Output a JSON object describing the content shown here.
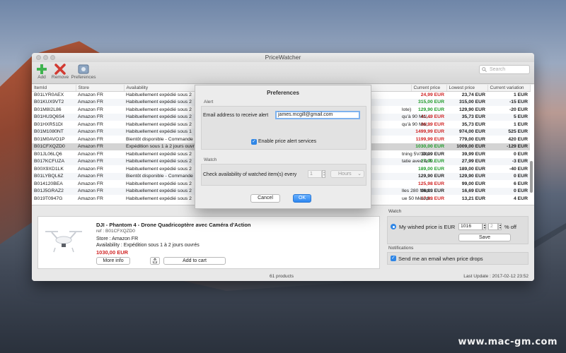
{
  "window": {
    "title": "PriceWatcher"
  },
  "toolbar": {
    "add_label": "Add",
    "remove_label": "Remove",
    "preferences_label": "Preferences",
    "search_placeholder": "Search"
  },
  "table": {
    "columns": [
      "ItemId",
      "Store",
      "Availability",
      "Current price",
      "Lowest price",
      "Current variation"
    ],
    "rows": [
      {
        "id": "B01LYR0AEX",
        "store": "Amazon FR",
        "avail": "Habituellement expédié sous 2",
        "extra": "",
        "current": "24,99 EUR",
        "current_color": "red",
        "lowest": "23,74 EUR",
        "variation": "1 EUR"
      },
      {
        "id": "B01KUX9VT2",
        "store": "Amazon FR",
        "avail": "Habituellement expédié sous 2",
        "extra": "",
        "current": "315,00 EUR",
        "current_color": "green",
        "lowest": "315,00 EUR",
        "variation": "-15 EUR"
      },
      {
        "id": "B01M8I2L86",
        "store": "Amazon FR",
        "avail": "Habituellement expédié sous 2",
        "extra": "lote)",
        "current": "129,90 EUR",
        "current_color": "green",
        "lowest": "129,90 EUR",
        "variation": "-20 EUR"
      },
      {
        "id": "B01HU3Q6S4",
        "store": "Amazon FR",
        "avail": "Habituellement expédié sous 2",
        "extra": "qu'à 90 Mo/...",
        "current": "41,49 EUR",
        "current_color": "red",
        "lowest": "35,73 EUR",
        "variation": "5 EUR"
      },
      {
        "id": "B01HXR51DI",
        "store": "Amazon FR",
        "avail": "Habituellement expédié sous 2",
        "extra": "qu'à 90 Mo/...",
        "current": "36,99 EUR",
        "current_color": "red",
        "lowest": "35,73 EUR",
        "variation": "1 EUR"
      },
      {
        "id": "B01M1080NT",
        "store": "Amazon FR",
        "avail": "Habituellement expédié sous 1",
        "extra": "",
        "current": "1499,99 EUR",
        "current_color": "red",
        "lowest": "974,00 EUR",
        "variation": "525 EUR"
      },
      {
        "id": "B01M0AVO1P",
        "store": "Amazon FR",
        "avail": "Bientôt disponible - Commande",
        "extra": "",
        "current": "1199,99 EUR",
        "current_color": "red",
        "lowest": "779,00 EUR",
        "variation": "420 EUR"
      },
      {
        "id": "B01CFXQZD0",
        "store": "Amazon FR",
        "avail": "Expédition sous 1 à 2 jours ouvr",
        "extra": "",
        "current": "1030,00 EUR",
        "current_color": "green",
        "lowest": "1009,00 EUR",
        "variation": "-129 EUR",
        "selected": true
      },
      {
        "id": "B01JL06LQ6",
        "store": "Amazon FR",
        "avail": "Habituellement expédié sous 2",
        "extra": "tning 5V/ 2A...",
        "current": "39,99 EUR",
        "current_color": "normal",
        "lowest": "39,99 EUR",
        "variation": "0 EUR"
      },
      {
        "id": "B017KCFUZA",
        "store": "Amazon FR",
        "avail": "Habituellement expédié sous 2",
        "extra": "tatie avec la T...",
        "current": "27,99 EUR",
        "current_color": "green",
        "lowest": "27,99 EUR",
        "variation": "-3 EUR"
      },
      {
        "id": "B00X9XD1LK",
        "store": "Amazon FR",
        "avail": "Habituellement expédié sous 2",
        "extra": "",
        "current": "189,00 EUR",
        "current_color": "green",
        "lowest": "189,00 EUR",
        "variation": "-40 EUR"
      },
      {
        "id": "B01LYBQL6Z",
        "store": "Amazon FR",
        "avail": "Bientôt disponible - Commande",
        "extra": "",
        "current": "129,90 EUR",
        "current_color": "normal",
        "lowest": "129,90 EUR",
        "variation": "0 EUR"
      },
      {
        "id": "B014120BEA",
        "store": "Amazon FR",
        "avail": "Habituellement expédié sous 2",
        "extra": "",
        "current": "125,98 EUR",
        "current_color": "red",
        "lowest": "99,00 EUR",
        "variation": "6 EUR"
      },
      {
        "id": "B01J5GRAZ2",
        "store": "Amazon FR",
        "avail": "Habituellement expédié sous 2",
        "extra": "lles 280 Mètr...",
        "current": "16,89 EUR",
        "current_color": "normal",
        "lowest": "16,69 EUR",
        "variation": "0 EUR"
      },
      {
        "id": "B019T0947G",
        "store": "Amazon FR",
        "avail": "Habituellement expédié sous 2",
        "extra": "ue 50 Mélodi...",
        "current": "17,99 EUR",
        "current_color": "red",
        "lowest": "13,21 EUR",
        "variation": "4 EUR"
      }
    ]
  },
  "product": {
    "title": "DJI - Phantom 4 - Drone Quadricoptère avec Caméra d'Action",
    "ref": "ref : B01CFXQZD0",
    "store": "Store : Amazon FR",
    "availability": "Availability : Expédition sous 1 à 2 jours ouvrés",
    "price": "1030,00 EUR",
    "more_info_label": "More info",
    "add_to_cart_label": "Add to cart"
  },
  "watch": {
    "section_label": "Watch",
    "wished_label": "My wished price is EUR",
    "wished_value": "1016",
    "percent_value": "2",
    "percent_label": "% off",
    "save_label": "Save"
  },
  "notifications": {
    "section_label": "Notifications",
    "email_label": "Send me an email when price drops"
  },
  "status": {
    "count": "61 products",
    "last_update": "Last Update : 2017-02-12 23:52"
  },
  "preferences": {
    "title": "Preferences",
    "alert_label": "Alert",
    "email_label": "Email address to receive alert",
    "email_value": "james.mcgill@gmail.com",
    "enable_label": "Enable price alert services",
    "watch_label": "Watch",
    "check_label": "Check availability of watched item(s) every",
    "interval_value": "1",
    "unit_value": "Hours",
    "cancel_label": "Cancel",
    "ok_label": "OK"
  },
  "watermark": "www.mac-gm.com",
  "colors": {
    "accent": "#2f86e6",
    "price_up": "#d02424",
    "price_down": "#1f9b2a"
  }
}
